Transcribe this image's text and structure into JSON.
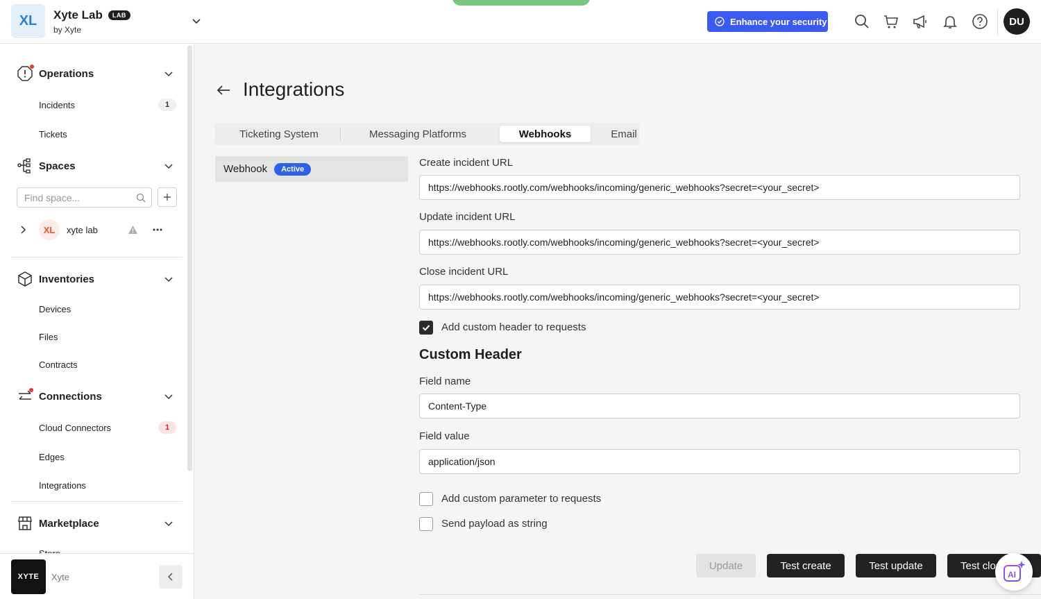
{
  "org": {
    "initials": "XL",
    "name": "Xyte Lab",
    "badge": "LAB",
    "sub": "by Xyte"
  },
  "header": {
    "enhance_label": "Enhance your security",
    "user_initials": "DU"
  },
  "sidebar": {
    "operations": {
      "label": "Operations",
      "items": [
        {
          "label": "Incidents",
          "count": "1"
        },
        {
          "label": "Tickets"
        }
      ]
    },
    "spaces": {
      "label": "Spaces",
      "search_placeholder": "Find space...",
      "space": {
        "initials": "XL",
        "name": "xyte lab"
      }
    },
    "inventories": {
      "label": "Inventories",
      "items": [
        {
          "label": "Devices"
        },
        {
          "label": "Files"
        },
        {
          "label": "Contracts"
        }
      ]
    },
    "connections": {
      "label": "Connections",
      "items": [
        {
          "label": "Cloud Connectors",
          "count": "1"
        },
        {
          "label": "Edges"
        },
        {
          "label": "Integrations"
        }
      ]
    },
    "marketplace": {
      "label": "Marketplace",
      "items": [
        {
          "label": "Store"
        }
      ]
    },
    "footer": {
      "logo_text": "XYTE",
      "name": "Xyte"
    }
  },
  "page": {
    "title": "Integrations",
    "tabs": [
      {
        "label": "Ticketing System"
      },
      {
        "label": "Messaging Platforms"
      },
      {
        "label": "Webhooks",
        "active": true
      },
      {
        "label": "Email"
      }
    ],
    "webhook": {
      "name": "Webhook",
      "status": "Active"
    },
    "form": {
      "create_label": "Create incident URL",
      "create_value": "https://webhooks.rootly.com/webhooks/incoming/generic_webhooks?secret=<your_secret>",
      "update_label": "Update incident URL",
      "update_value": "https://webhooks.rootly.com/webhooks/incoming/generic_webhooks?secret=<your_secret>",
      "close_label": "Close incident URL",
      "close_value": "https://webhooks.rootly.com/webhooks/incoming/generic_webhooks?secret=<your_secret>",
      "custom_header_check": "Add custom header to requests",
      "custom_header_checked": true,
      "custom_header_title": "Custom Header",
      "field_name_label": "Field name",
      "field_name_value": "Content-Type",
      "field_value_label": "Field value",
      "field_value_value": "application/json",
      "custom_param_check": "Add custom parameter to requests",
      "custom_param_checked": false,
      "payload_string_check": "Send payload as string",
      "payload_string_checked": false
    },
    "buttons": {
      "update": "Update",
      "test_create": "Test create",
      "test_update": "Test update",
      "test_close": "Test close"
    }
  },
  "colors": {
    "accent_blue": "#3b5bf0",
    "active_pill": "#2f63e6",
    "dark_button": "#222222",
    "alert_red": "#e53935"
  }
}
